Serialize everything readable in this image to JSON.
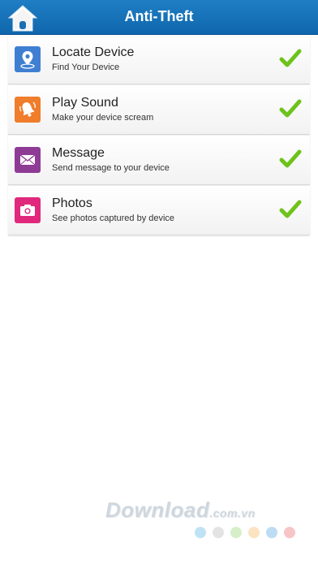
{
  "header": {
    "title": "Anti-Theft",
    "home_icon": "home-icon",
    "color": "#1873bb"
  },
  "items": [
    {
      "title": "Locate Device",
      "subtitle": "Find Your Device",
      "icon": "location-pin-icon",
      "icon_color": "#3f7fd2",
      "checked": true
    },
    {
      "title": "Play Sound",
      "subtitle": "Make your device scream",
      "icon": "bell-icon",
      "icon_color": "#ef7d2b",
      "checked": true
    },
    {
      "title": "Message",
      "subtitle": "Send message to your device",
      "icon": "envelope-icon",
      "icon_color": "#8e3b96",
      "checked": true
    },
    {
      "title": "Photos",
      "subtitle": "See photos captured by device",
      "icon": "camera-icon",
      "icon_color": "#e0287d",
      "checked": true
    }
  ],
  "check_color": "#6ec31b",
  "watermark": {
    "text": "Download",
    "domain": ".com.vn",
    "dot_colors": [
      "#bfe3f5",
      "#e3e3e3",
      "#d6efc9",
      "#fbe4c2",
      "#bcdcf3",
      "#f8c5c7"
    ]
  }
}
